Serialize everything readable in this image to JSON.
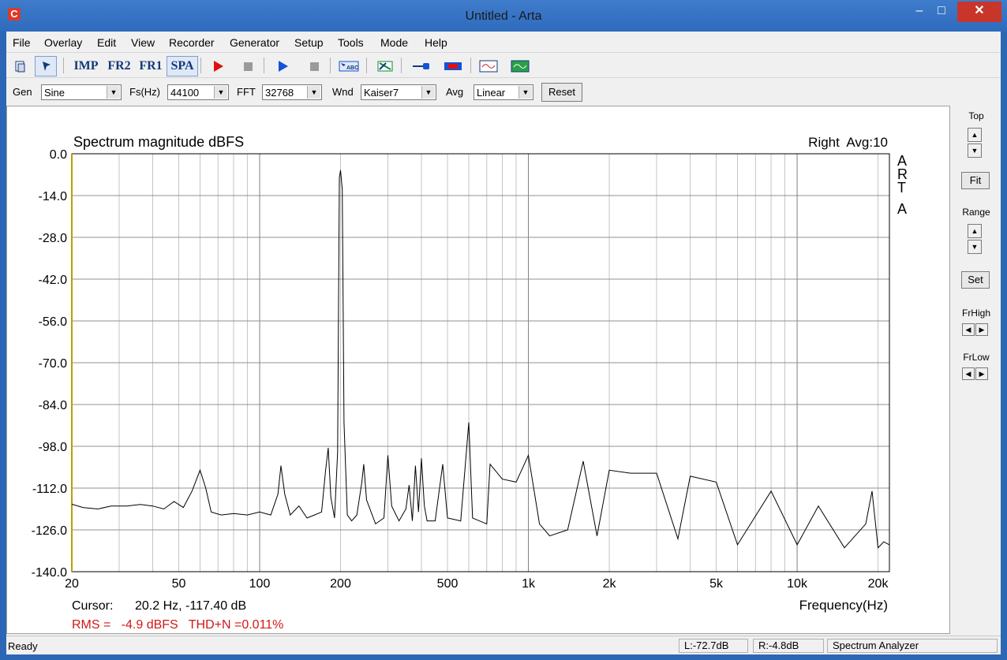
{
  "window": {
    "title": "Untitled - Arta",
    "app_icon": "arta-c-icon"
  },
  "menu": [
    "File",
    "Overlay",
    "Edit",
    "View",
    "Recorder",
    "Generator",
    "Setup",
    "Tools",
    "Mode",
    "Help"
  ],
  "toolbar": {
    "imp": "IMP",
    "fr2": "FR2",
    "fr1": "FR1",
    "spa": "SPA"
  },
  "controls": {
    "gen_label": "Gen",
    "gen_value": "Sine",
    "fs_label": "Fs(Hz)",
    "fs_value": "44100",
    "fft_label": "FFT",
    "fft_value": "32768",
    "wnd_label": "Wnd",
    "wnd_value": "Kaiser7",
    "avg_label": "Avg",
    "avg_value": "Linear",
    "reset_label": "Reset"
  },
  "side_panel": {
    "top_label": "Top",
    "fit_label": "Fit",
    "range_label": "Range",
    "set_label": "Set",
    "frhigh_label": "FrHigh",
    "frlow_label": "FrLow"
  },
  "chart": {
    "title": "Spectrum magnitude dBFS",
    "channel_info": "Right  Avg:10",
    "watermark": "ARTA",
    "xlabel": "Frequency(Hz)",
    "cursor_label": "Cursor:",
    "cursor_value": "20.2 Hz, -117.40 dB",
    "rms_text": "RMS =   -4.9 dBFS   THD+N =0.011%"
  },
  "chart_data": {
    "type": "line",
    "xscale": "log",
    "xlim": [
      20,
      22050
    ],
    "ylim": [
      -140,
      0
    ],
    "yticks": [
      0,
      -14,
      -28,
      -42,
      -56,
      -70,
      -84,
      -98,
      -112,
      -126,
      -140
    ],
    "ytick_labels": [
      "0.0",
      "-14.0",
      "-28.0",
      "-42.0",
      "-56.0",
      "-70.0",
      "-84.0",
      "-98.0",
      "-112.0",
      "-126.0",
      "-140.0"
    ],
    "xtick_values": [
      20,
      50,
      100,
      200,
      500,
      1000,
      2000,
      5000,
      10000,
      20000
    ],
    "xtick_labels": [
      "20",
      "50",
      "100",
      "200",
      "500",
      "1k",
      "2k",
      "5k",
      "10k",
      "20k"
    ],
    "grid": true,
    "series": [
      {
        "color": "#000000",
        "points": [
          [
            20,
            -117.4
          ],
          [
            22,
            -118.5
          ],
          [
            25,
            -119
          ],
          [
            28,
            -118
          ],
          [
            32,
            -118
          ],
          [
            36,
            -117.5
          ],
          [
            40,
            -118
          ],
          [
            44,
            -119
          ],
          [
            48,
            -116.5
          ],
          [
            52,
            -118.5
          ],
          [
            56,
            -113
          ],
          [
            60,
            -106
          ],
          [
            63,
            -112
          ],
          [
            66,
            -120
          ],
          [
            72,
            -121
          ],
          [
            80,
            -120.5
          ],
          [
            90,
            -121
          ],
          [
            100,
            -120
          ],
          [
            110,
            -121
          ],
          [
            117,
            -114
          ],
          [
            120,
            -104.5
          ],
          [
            124,
            -114
          ],
          [
            130,
            -121
          ],
          [
            140,
            -118
          ],
          [
            150,
            -122
          ],
          [
            160,
            -121
          ],
          [
            170,
            -120
          ],
          [
            176,
            -106
          ],
          [
            180,
            -98.5
          ],
          [
            184,
            -115
          ],
          [
            190,
            -122
          ],
          [
            195,
            -100
          ],
          [
            198,
            -8
          ],
          [
            200,
            -5.5
          ],
          [
            203,
            -12
          ],
          [
            206,
            -90
          ],
          [
            212,
            -121
          ],
          [
            220,
            -123
          ],
          [
            230,
            -121
          ],
          [
            240,
            -110
          ],
          [
            244,
            -104
          ],
          [
            250,
            -116
          ],
          [
            270,
            -124
          ],
          [
            290,
            -122
          ],
          [
            300,
            -101
          ],
          [
            310,
            -118
          ],
          [
            330,
            -123
          ],
          [
            350,
            -119
          ],
          [
            360,
            -111
          ],
          [
            370,
            -123
          ],
          [
            380,
            -104.5
          ],
          [
            390,
            -120
          ],
          [
            400,
            -102
          ],
          [
            410,
            -118
          ],
          [
            420,
            -123
          ],
          [
            450,
            -123
          ],
          [
            480,
            -104
          ],
          [
            500,
            -122
          ],
          [
            560,
            -123
          ],
          [
            600,
            -90
          ],
          [
            620,
            -122
          ],
          [
            700,
            -124
          ],
          [
            720,
            -104
          ],
          [
            800,
            -109
          ],
          [
            900,
            -110
          ],
          [
            1000,
            -101
          ],
          [
            1100,
            -124
          ],
          [
            1200,
            -128
          ],
          [
            1400,
            -126
          ],
          [
            1600,
            -103
          ],
          [
            1800,
            -128
          ],
          [
            2000,
            -106
          ],
          [
            2400,
            -107
          ],
          [
            3000,
            -107
          ],
          [
            3600,
            -129
          ],
          [
            4000,
            -108
          ],
          [
            5000,
            -110
          ],
          [
            6000,
            -131
          ],
          [
            8000,
            -113
          ],
          [
            10000,
            -131
          ],
          [
            12000,
            -118
          ],
          [
            15000,
            -132
          ],
          [
            18000,
            -124
          ],
          [
            19000,
            -113
          ],
          [
            20000,
            -132
          ],
          [
            21000,
            -130
          ],
          [
            22050,
            -131
          ]
        ]
      }
    ]
  },
  "status": {
    "ready": "Ready",
    "left_level": "L:-72.7dB",
    "right_level": "R:-4.8dB",
    "mode": "Spectrum Analyzer"
  }
}
